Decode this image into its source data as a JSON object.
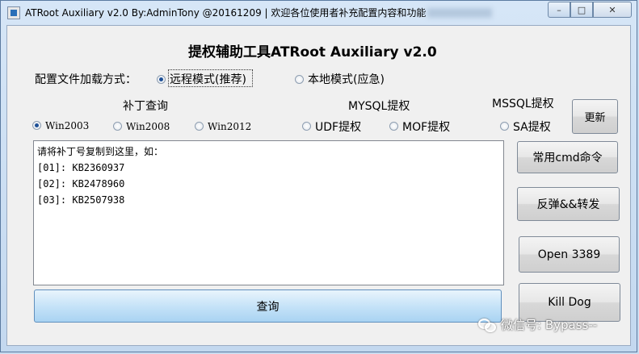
{
  "window": {
    "title": "ATRoot Auxiliary v2.0  By:AdminTony @20161209 | 欢迎各位使用者补充配置内容和功能",
    "controls": {
      "minimize": "–",
      "maximize": "□",
      "close": "✕"
    }
  },
  "header": {
    "title": "提权辅助工具ATRoot Auxiliary v2.0"
  },
  "config": {
    "label": "配置文件加载方式：",
    "options": [
      {
        "label": "远程模式(推荐)",
        "selected": true
      },
      {
        "label": "本地模式(应急)",
        "selected": false
      }
    ]
  },
  "sections": {
    "patch": "补丁查询",
    "mysql": "MYSQL提权",
    "mssql": "MSSQL提权"
  },
  "os_options": [
    {
      "label": "Win2003",
      "selected": true
    },
    {
      "label": "Win2008",
      "selected": false
    },
    {
      "label": "Win2012",
      "selected": false
    }
  ],
  "mysql_options": [
    {
      "label": "UDF提权",
      "selected": false
    },
    {
      "label": "MOF提权",
      "selected": false
    }
  ],
  "mssql_options": [
    {
      "label": "SA提权",
      "selected": false
    }
  ],
  "buttons": {
    "update": "更新",
    "cmd": "常用cmd命令",
    "reverse": "反弹&&转发",
    "open3389": "Open 3389",
    "killdog": "Kill Dog",
    "query": "查询"
  },
  "textarea": {
    "lines": [
      "请将补丁号复制到这里，如：",
      "[01]: KB2360937",
      "[02]: KB2478960",
      "[03]: KB2507938"
    ]
  },
  "watermark": "微信号: Bypass--"
}
